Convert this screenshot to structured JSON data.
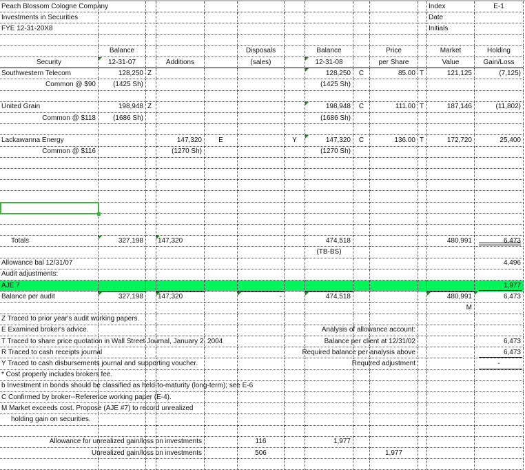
{
  "sheet": {
    "selected_cell": {
      "row": 18,
      "col": 0
    },
    "green_rows": [
      25
    ],
    "rows": [
      {
        "cells": [
          {
            "c": 0,
            "t": "Peach Blossom Cologne Company"
          },
          {
            "c": 11,
            "t": "Index"
          },
          {
            "c": 12,
            "t": "E-1",
            "a": "c"
          }
        ]
      },
      {
        "cells": [
          {
            "c": 0,
            "t": "Investments in Securities"
          },
          {
            "c": 11,
            "t": "Date"
          }
        ]
      },
      {
        "cells": [
          {
            "c": 0,
            "t": "FYE 12-31-20X8"
          },
          {
            "c": 11,
            "t": "Initials"
          }
        ]
      },
      {
        "cells": []
      },
      {
        "cells": [
          {
            "c": 1,
            "t": "Balance",
            "a": "c"
          },
          {
            "c": 5,
            "t": "Disposals",
            "a": "c"
          },
          {
            "c": 7,
            "t": "Balance",
            "a": "c"
          },
          {
            "c": 9,
            "t": "Price",
            "a": "c"
          },
          {
            "c": 11,
            "t": "Market",
            "a": "c"
          },
          {
            "c": 12,
            "t": "Holding",
            "a": "c"
          }
        ]
      },
      {
        "solid": true,
        "cells": [
          {
            "c": 0,
            "t": "Security",
            "a": "c"
          },
          {
            "c": 1,
            "t": "12-31-07",
            "a": "c",
            "m": true
          },
          {
            "c": 3,
            "t": "Additions",
            "a": "c"
          },
          {
            "c": 5,
            "t": "(sales)",
            "a": "c"
          },
          {
            "c": 7,
            "t": "12-31-08",
            "a": "c",
            "m": true
          },
          {
            "c": 9,
            "t": "per Share",
            "a": "c"
          },
          {
            "c": 11,
            "t": "Value",
            "a": "c"
          },
          {
            "c": 12,
            "t": "Gain/Loss",
            "a": "c"
          }
        ]
      },
      {
        "cells": [
          {
            "c": 0,
            "t": "Southwestern Telecom"
          },
          {
            "c": 1,
            "t": "128,250",
            "a": "r"
          },
          {
            "c": 2,
            "t": "Z"
          },
          {
            "c": 7,
            "t": "128,250",
            "a": "r",
            "m": true
          },
          {
            "c": 8,
            "t": "C",
            "a": "c"
          },
          {
            "c": 9,
            "t": "85.00",
            "a": "r"
          },
          {
            "c": 10,
            "t": "T"
          },
          {
            "c": 11,
            "t": "121,125",
            "a": "r"
          },
          {
            "c": 12,
            "t": "(7,125)",
            "a": "r"
          }
        ]
      },
      {
        "cells": [
          {
            "c": 0,
            "t": "Common @ $90",
            "a": "r"
          },
          {
            "c": 1,
            "t": "(1425 Sh)",
            "a": "r"
          },
          {
            "c": 7,
            "t": "(1425 Sh)",
            "a": "r"
          }
        ]
      },
      {
        "cells": []
      },
      {
        "cells": [
          {
            "c": 0,
            "t": "United Grain"
          },
          {
            "c": 1,
            "t": "198,948",
            "a": "r"
          },
          {
            "c": 2,
            "t": "Z"
          },
          {
            "c": 7,
            "t": "198,948",
            "a": "r",
            "m": true
          },
          {
            "c": 8,
            "t": "C",
            "a": "c"
          },
          {
            "c": 9,
            "t": "111.00",
            "a": "r"
          },
          {
            "c": 10,
            "t": "T"
          },
          {
            "c": 11,
            "t": "187,146",
            "a": "r"
          },
          {
            "c": 12,
            "t": "(11,802)",
            "a": "r"
          }
        ]
      },
      {
        "cells": [
          {
            "c": 0,
            "t": "Common @ $118",
            "a": "r"
          },
          {
            "c": 1,
            "t": "(1686 Sh)",
            "a": "r"
          },
          {
            "c": 7,
            "t": "(1686 Sh)",
            "a": "r"
          }
        ]
      },
      {
        "cells": []
      },
      {
        "cells": [
          {
            "c": 0,
            "t": "Lackawanna Energy"
          },
          {
            "c": 3,
            "t": "147,320",
            "a": "r"
          },
          {
            "c": 4,
            "t": "E",
            "a": "c"
          },
          {
            "c": 6,
            "t": "Y",
            "a": "c"
          },
          {
            "c": 7,
            "t": "147,320",
            "a": "r",
            "m": true
          },
          {
            "c": 8,
            "t": "C",
            "a": "c"
          },
          {
            "c": 9,
            "t": "136.00",
            "a": "r"
          },
          {
            "c": 10,
            "t": "T"
          },
          {
            "c": 11,
            "t": "172,720",
            "a": "r"
          },
          {
            "c": 12,
            "t": "25,400",
            "a": "r"
          }
        ]
      },
      {
        "cells": [
          {
            "c": 0,
            "t": "Common @ $116",
            "a": "r"
          },
          {
            "c": 3,
            "t": "(1270 Sh)",
            "a": "r"
          },
          {
            "c": 7,
            "t": "(1270 Sh)",
            "a": "r"
          }
        ]
      },
      {
        "cells": []
      },
      {
        "cells": []
      },
      {
        "cells": []
      },
      {
        "cells": []
      },
      {
        "cells": []
      },
      {
        "cells": []
      },
      {
        "cells": []
      },
      {
        "cells": [
          {
            "c": 0,
            "t": "Totals",
            "a": "i"
          },
          {
            "c": 1,
            "t": "327,198",
            "a": "r",
            "m": true
          },
          {
            "c": 3,
            "t": "147,320",
            "a": "l",
            "m": true
          },
          {
            "c": 7,
            "t": "474,518",
            "a": "r"
          },
          {
            "c": 11,
            "t": "480,991",
            "a": "r"
          },
          {
            "c": 12,
            "t": "6,473",
            "a": "r",
            "u": "double"
          }
        ]
      },
      {
        "cells": [
          {
            "c": 7,
            "t": "(TB-BS)",
            "a": "c"
          }
        ]
      },
      {
        "cells": [
          {
            "c": 0,
            "t": "Allowance bal 12/31/07"
          },
          {
            "c": 12,
            "t": "4,496",
            "a": "r"
          }
        ]
      },
      {
        "cells": [
          {
            "c": 0,
            "t": "Audit adjustments:"
          }
        ]
      },
      {
        "cells": [
          {
            "c": 0,
            "t": "AJE 7"
          },
          {
            "c": 12,
            "t": "1,977",
            "a": "r",
            "u": "single"
          }
        ]
      },
      {
        "top": [
          1,
          3,
          5,
          7,
          11
        ],
        "cells": [
          {
            "c": 0,
            "t": "Balance per audit"
          },
          {
            "c": 1,
            "t": "327,198",
            "a": "r",
            "m": true
          },
          {
            "c": 3,
            "t": "147,320",
            "a": "l",
            "m": true
          },
          {
            "c": 5,
            "t": "-",
            "a": "r",
            "m": true
          },
          {
            "c": 7,
            "t": "474,518",
            "a": "r",
            "m": true
          },
          {
            "c": 11,
            "t": "480,991",
            "a": "r",
            "m": true
          },
          {
            "c": 12,
            "t": "6,473",
            "a": "r",
            "m": true
          }
        ]
      },
      {
        "cells": [
          {
            "c": 11,
            "t": "M",
            "a": "r"
          }
        ]
      },
      {
        "cells": [
          {
            "c": 0,
            "t": "Z  Traced to prior year's audit working papers."
          }
        ]
      },
      {
        "cells": [
          {
            "c": 0,
            "t": "E  Examined broker's advice."
          },
          {
            "c": 9,
            "t": "Analysis of allowance account:",
            "a": "r"
          }
        ]
      },
      {
        "cells": [
          {
            "c": 0,
            "t": "T  Traced to share price quotation in Wall Street Journal, January 2, 2004"
          },
          {
            "c": 9,
            "t": "Balance per client at 12/31/02",
            "a": "r"
          },
          {
            "c": 12,
            "t": "6,473",
            "a": "r"
          }
        ]
      },
      {
        "cells": [
          {
            "c": 0,
            "t": "R  Traced to cash receipts journal"
          },
          {
            "c": 9,
            "t": "Required balance per analysis above",
            "a": "r"
          },
          {
            "c": 12,
            "t": "6,473",
            "a": "r",
            "u": "single"
          }
        ]
      },
      {
        "cells": [
          {
            "c": 0,
            "t": "Y  Traced to cash disbursements journal and supporting voucher."
          },
          {
            "c": 9,
            "t": "Required adjustment",
            "a": "r"
          },
          {
            "c": 12,
            "t": "-",
            "a": "c",
            "u": "single"
          }
        ]
      },
      {
        "cells": [
          {
            "c": 0,
            "t": "*  Cost properly includes brokers fee."
          }
        ]
      },
      {
        "cells": [
          {
            "c": 0,
            "t": "b  Investment in bonds should be classified as held-to-maturity (long-term); see E-6"
          }
        ]
      },
      {
        "cells": [
          {
            "c": 0,
            "t": "C  Confirmed by broker--Reference working paper (E-4)."
          }
        ]
      },
      {
        "cells": [
          {
            "c": 0,
            "t": "M  Market exceeds cost. Propose (AJE #7) to record unrealized"
          }
        ]
      },
      {
        "cells": [
          {
            "c": 0,
            "t": "holding gain on securities.",
            "a": "i"
          }
        ]
      },
      {
        "cells": []
      },
      {
        "cells": [
          {
            "c": 3,
            "t": "Allowance for unrealized gain/loss on investments",
            "a": "r"
          },
          {
            "c": 5,
            "t": "116",
            "a": "c"
          },
          {
            "c": 7,
            "t": "1,977",
            "a": "r"
          }
        ]
      },
      {
        "cells": [
          {
            "c": 3,
            "t": "Unrealized gain/loss on investments",
            "a": "r"
          },
          {
            "c": 5,
            "t": "506",
            "a": "c"
          },
          {
            "c": 9,
            "t": "1,977",
            "a": "c"
          }
        ]
      },
      {
        "cells": []
      }
    ]
  }
}
